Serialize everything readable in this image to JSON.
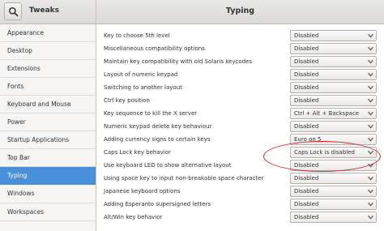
{
  "app": {
    "title": "Tweaks"
  },
  "page": {
    "title": "Typing"
  },
  "sidebar": {
    "items": [
      {
        "label": "Appearance"
      },
      {
        "label": "Desktop"
      },
      {
        "label": "Extensions"
      },
      {
        "label": "Fonts"
      },
      {
        "label": "Keyboard and Mouse"
      },
      {
        "label": "Power"
      },
      {
        "label": "Startup Applications"
      },
      {
        "label": "Top Bar"
      },
      {
        "label": "Typing"
      },
      {
        "label": "Windows"
      },
      {
        "label": "Workspaces"
      }
    ],
    "active": "Typing"
  },
  "settings": [
    {
      "label": "Key to choose 5th level",
      "value": "Disabled"
    },
    {
      "label": "Miscellaneous compatibility options",
      "value": "Disabled"
    },
    {
      "label": "Maintain key compatibility with old Solaris keycodes",
      "value": "Disabled"
    },
    {
      "label": "Layout of numeric keypad",
      "value": "Disabled"
    },
    {
      "label": "Switching to another layout",
      "value": "Disabled"
    },
    {
      "label": "Ctrl key position",
      "value": "Disabled"
    },
    {
      "label": "Key sequence to kill the X server",
      "value": "Ctrl + Alt + Backspace"
    },
    {
      "label": "Numeric keypad delete key behaviour",
      "value": "Disabled"
    },
    {
      "label": "Adding currency signs to certain keys",
      "value": "Euro on 5"
    },
    {
      "label": "Caps Lock key behavior",
      "value": "Caps Lock is disabled"
    },
    {
      "label": "Use keyboard LED to show alternative layout",
      "value": "Disabled"
    },
    {
      "label": "Using space key to input non-breakable space character",
      "value": "Disabled"
    },
    {
      "label": "Japanese keyboard options",
      "value": "Disabled"
    },
    {
      "label": "Adding Esperanto supersigned letters",
      "value": "Disabled"
    },
    {
      "label": "Alt/Win key behavior",
      "value": "Disabled"
    }
  ],
  "highlight": {
    "color": "#d2232a"
  },
  "colors": {
    "accent": "#4a90d9"
  },
  "icons": {
    "search": "search-icon",
    "dropdown": "chevron-down-icon"
  }
}
